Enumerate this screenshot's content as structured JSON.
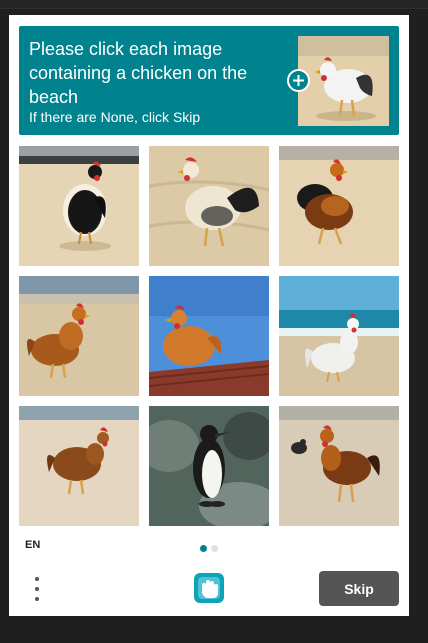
{
  "challenge": {
    "prompt": "Please click each image containing a chicken on the beach",
    "subprompt": "If there are None, click Skip"
  },
  "tiles": [
    {
      "subject": "black chicken on sand",
      "selected": false
    },
    {
      "subject": "white and black rooster on sand",
      "selected": false
    },
    {
      "subject": "brown rooster on sand",
      "selected": false
    },
    {
      "subject": "brown hen walking on beach",
      "selected": false
    },
    {
      "subject": "hen on a roof under blue sky",
      "selected": false
    },
    {
      "subject": "white chicken on beach by the sea",
      "selected": false
    },
    {
      "subject": "brown hen on beach",
      "selected": false
    },
    {
      "subject": "penguin on rocks",
      "selected": false
    },
    {
      "subject": "rooster on beach",
      "selected": false
    }
  ],
  "footer": {
    "language": "EN",
    "skip_label": "Skip",
    "page_indicator": {
      "current": 1,
      "total": 2
    }
  },
  "icons": {
    "menu": "more-vertical-icon",
    "logo": "hcaptcha-hand-icon",
    "add": "plus-icon"
  },
  "colors": {
    "header": "#00838f",
    "skip_button": "#555555",
    "dot_active": "#00838f",
    "dot_inactive": "#e0e0e0"
  }
}
